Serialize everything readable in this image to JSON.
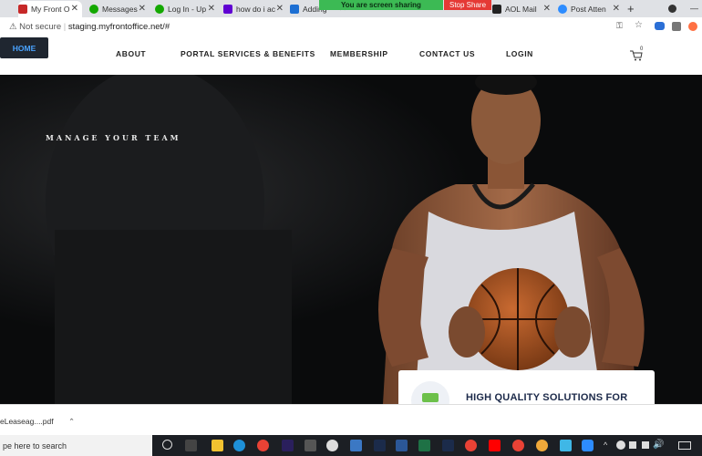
{
  "browser": {
    "tabs": [
      {
        "label": "My Front O",
        "fav_color": "#c62828"
      },
      {
        "label": "Messages",
        "fav_color": "#14a800"
      },
      {
        "label": "Log In - Up",
        "fav_color": "#14a800"
      },
      {
        "label": "how do i ac",
        "fav_color": "#6001d2"
      },
      {
        "label": "Adding",
        "fav_color": "#1d6fd3"
      },
      {
        "label": "",
        "fav_color": "#444444"
      },
      {
        "label": "AOL Mail",
        "fav_color": "#222222"
      },
      {
        "label": "Post Atten",
        "fav_color": "#2d8cff"
      }
    ],
    "share_text": "You are screen sharing",
    "stop_share_label": "Stop Share",
    "address": {
      "security": "Not secure",
      "url": "staging.myfrontoffice.net/#"
    }
  },
  "nav": {
    "home": "HOME",
    "about": "ABOUT",
    "portal": "PORTAL SERVICES & BENEFITS",
    "membership": "MEMBERSHIP",
    "contact": "CONTACT US",
    "login": "LOGIN",
    "cart_count": "0"
  },
  "hero": {
    "tagline": "MANAGE YOUR TEAM",
    "card_title": "HIGH QUALITY SOLUTIONS FOR YOUR"
  },
  "downloads": {
    "file": "eLeaseag....pdf"
  },
  "taskbar": {
    "search_placeholder": "pe here to search"
  }
}
